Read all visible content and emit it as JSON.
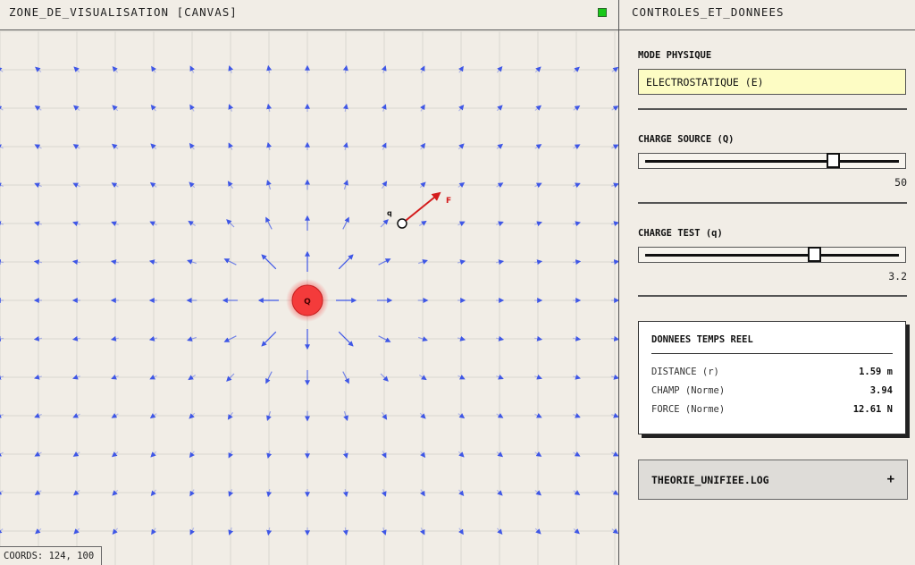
{
  "canvas_pane": {
    "title": "ZONE_DE_VISUALISATION [CANVAS]",
    "status_color": "#19c919",
    "coords_label": "COORDS: 124, 100",
    "source_label": "Q",
    "test_label": "q",
    "force_label": "F",
    "colors": {
      "field_arrow": "#3f57e6",
      "source": "#f43b3b",
      "force": "#d41c1c",
      "grid": "#d9d6d0"
    }
  },
  "controls": {
    "title": "CONTROLES_ET_DONNEES",
    "mode_label": "MODE PHYSIQUE",
    "mode_value": "ELECTROSTATIQUE (E)",
    "source_label": "CHARGE SOURCE (Q)",
    "source_value": "50",
    "source_fraction": 0.75,
    "test_label": "CHARGE TEST (q)",
    "test_value": "3.2",
    "test_fraction": 0.67,
    "realtime": {
      "title": "DONNEES TEMPS REEL",
      "rows": [
        {
          "key": "DISTANCE (r)",
          "value": "1.59 m"
        },
        {
          "key": "CHAMP (Norme)",
          "value": "3.94"
        },
        {
          "key": "FORCE (Norme)",
          "value": "12.61 N"
        }
      ]
    },
    "theory_label": "THEORIE_UNIFIEE.LOG",
    "theory_toggle": "+"
  }
}
